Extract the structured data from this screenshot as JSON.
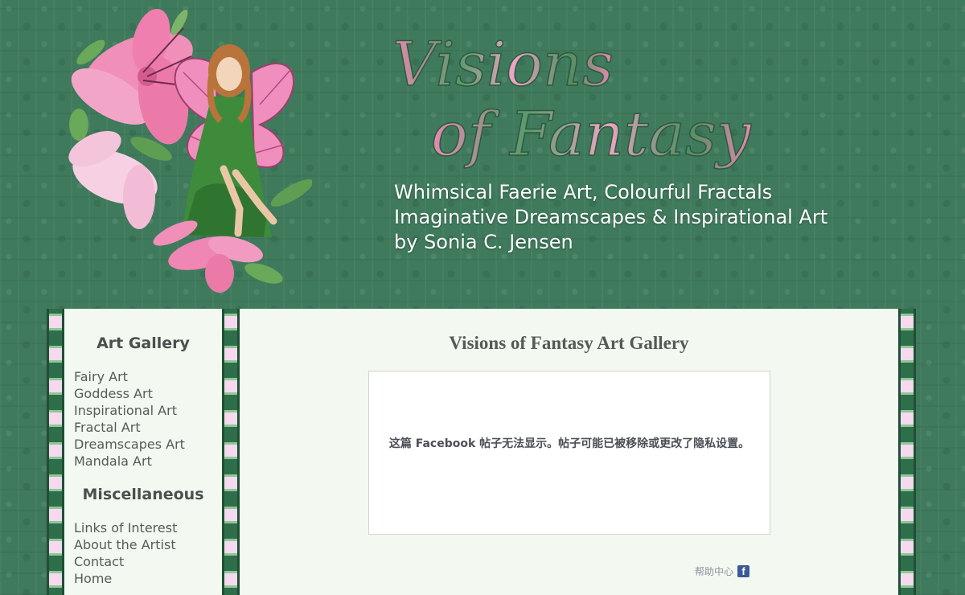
{
  "header": {
    "logo_text": "Visions of Fantasy",
    "tagline": [
      "Whimsical Faerie Art, Colourful Fractals",
      "Imaginative Dreamscapes & Inspirational Art",
      "by Sonia C. Jensen"
    ]
  },
  "sidebar": {
    "sections": [
      {
        "heading": "Art Gallery",
        "items": [
          "Fairy Art",
          "Goddess Art",
          "Inspirational Art",
          "Fractal Art",
          "Dreamscapes Art",
          "Mandala Art"
        ]
      },
      {
        "heading": "Miscellaneous",
        "items": [
          "Links of Interest",
          "About the Artist",
          "Contact",
          "Home"
        ]
      }
    ]
  },
  "main": {
    "title": "Visions of Fantasy Art Gallery",
    "facebook_embed": {
      "message": "这篇 Facebook 帖子无法显示。帖子可能已被移除或更改了隐私设置。",
      "help_link": "帮助中心",
      "icon": "facebook-icon",
      "icon_glyph": "f"
    }
  },
  "colors": {
    "background_green": "#3f7a5c",
    "panel_bg": "#f3f8f1",
    "heading_text": "#4b4f4d",
    "logo_pink": "#e889b1",
    "logo_green": "#3e8a5a",
    "facebook_blue": "#3b5998"
  }
}
